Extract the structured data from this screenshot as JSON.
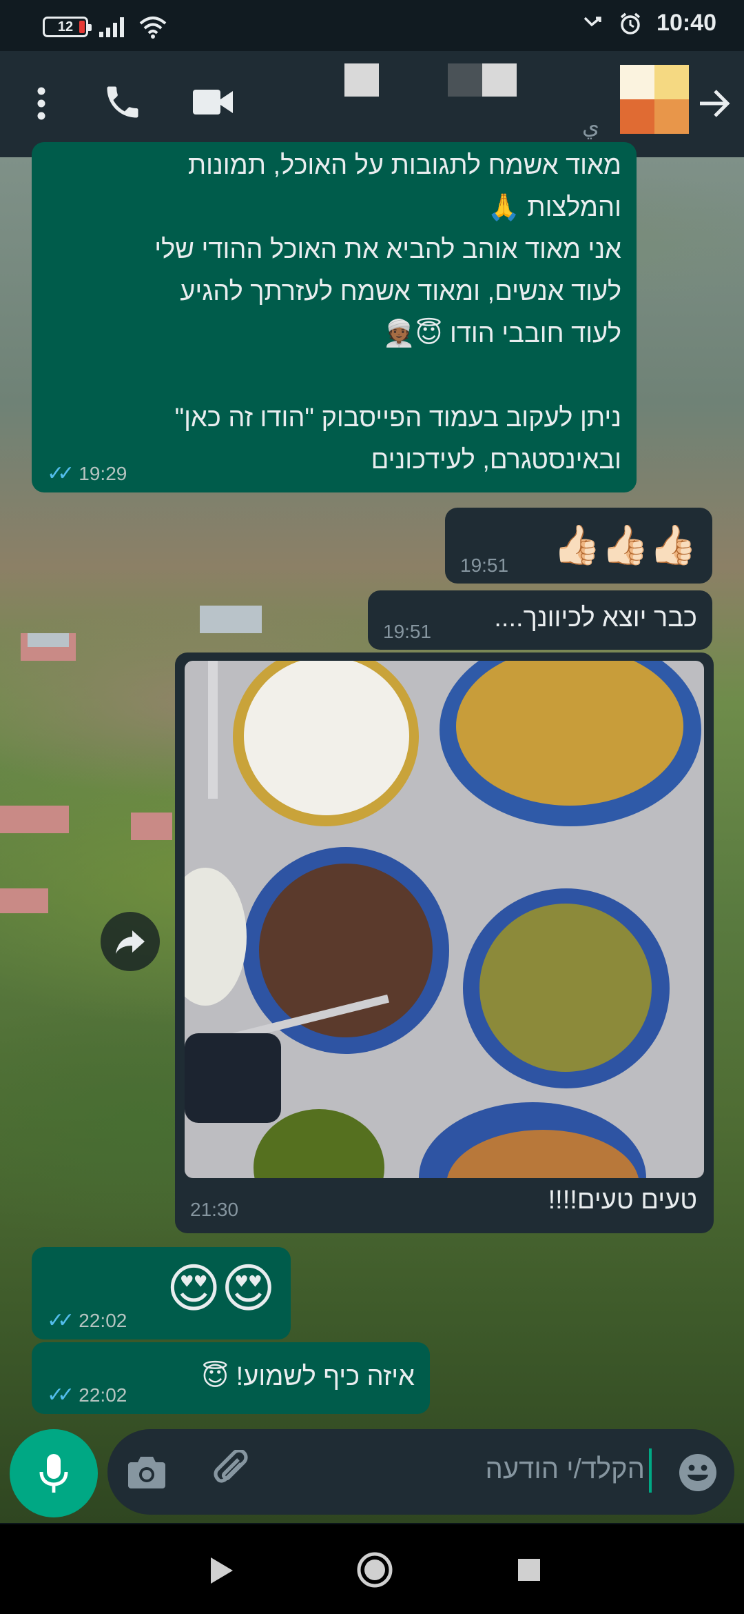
{
  "status_bar": {
    "battery_level": "12",
    "time": "10:40"
  },
  "header": {
    "contact_name": "ي",
    "back_icon": "arrow-forward-icon",
    "icons": [
      "more-vert-icon",
      "phone-icon",
      "video-camera-icon"
    ]
  },
  "messages": [
    {
      "direction": "outgoing",
      "lines": [
        "מאוד אשמח לתגובות על האוכל, תמונות",
        "והמלצות 🙏",
        "אני מאוד אוהב להביא את האוכל ההודי שלי",
        "לעוד אנשים, ומאוד אשמח לעזרתך להגיע",
        "לעוד חובבי הודו 😇👳🏾",
        "",
        "ניתן לעקוב בעמוד הפייסבוק \"הודו זה כאן\"",
        "ובאינסטגרם, לעידכונים"
      ],
      "time": "19:29",
      "status": "read"
    },
    {
      "direction": "incoming",
      "text": "👍🏻👍🏻👍🏻",
      "time": "19:51"
    },
    {
      "direction": "incoming",
      "text": "כבר יוצא לכיוונך....",
      "time": "19:51"
    },
    {
      "direction": "incoming",
      "has_image": true,
      "text": "טעים טעים!!!!",
      "time": "21:30"
    },
    {
      "direction": "outgoing",
      "text": "😍😍",
      "time": "22:02",
      "status": "read"
    },
    {
      "direction": "outgoing",
      "text": "איזה כיף לשמוע! 😇",
      "time": "22:02",
      "status": "read"
    }
  ],
  "input": {
    "placeholder": "הקלד/י הודעה"
  },
  "colors": {
    "outgoing_bubble": "#005c4b",
    "incoming_bubble": "#1f2c34",
    "accent": "#00a884",
    "read_ticks": "#53bdeb"
  }
}
